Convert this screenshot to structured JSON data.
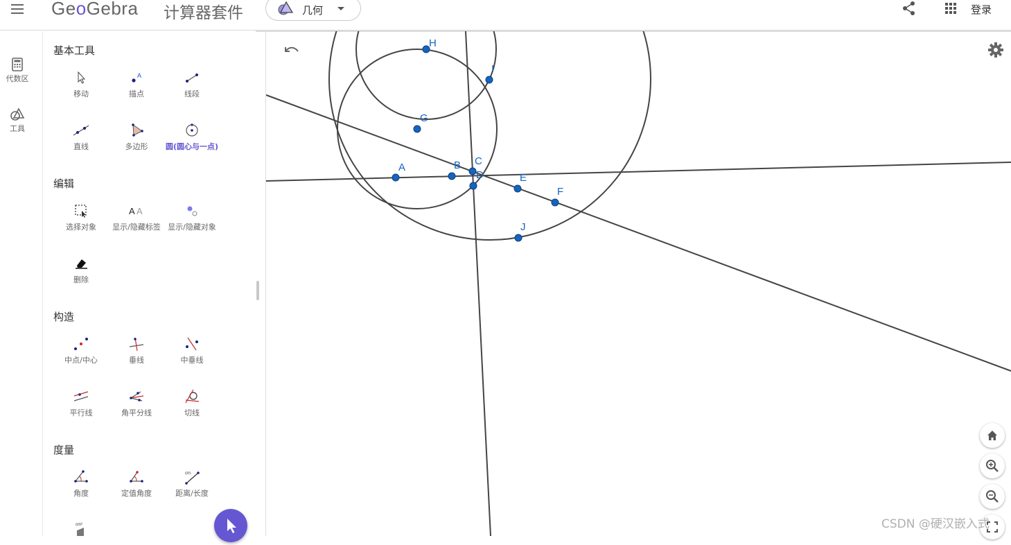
{
  "header": {
    "logo": {
      "left": "Ge",
      "oo": "o",
      "right": "Gebra"
    },
    "suite_title": "计算器套件",
    "app_selector": {
      "selected": "几何"
    },
    "login": "登录"
  },
  "rail": {
    "algebra": "代数区",
    "tools": "工具"
  },
  "tools_panel": {
    "sections": {
      "basic": "基本工具",
      "edit": "编辑",
      "construct": "构造",
      "measure": "度量"
    },
    "tools": {
      "move": "移动",
      "point": "描点",
      "segment": "线段",
      "line": "直线",
      "polygon": "多边形",
      "circle": "圆(圆心与一点)",
      "select": "选择对象",
      "show_hide_label": "显示/隐藏标签",
      "show_hide_object": "显示/隐藏对象",
      "delete": "删除",
      "midpoint": "中点/中心",
      "perpendicular": "垂线",
      "perp_bisector": "中垂线",
      "parallel": "平行线",
      "angle_bisector": "角平分线",
      "tangent": "切线",
      "angle": "角度",
      "fixed_angle": "定值角度",
      "distance": "距离/长度",
      "area_icon_text": "cm²"
    }
  },
  "graphics": {
    "points": [
      {
        "name": "A"
      },
      {
        "name": "B"
      },
      {
        "name": "C"
      },
      {
        "name": "D"
      },
      {
        "name": "E"
      },
      {
        "name": "F"
      },
      {
        "name": "G"
      },
      {
        "name": "H"
      },
      {
        "name": "I"
      },
      {
        "name": "J"
      }
    ],
    "colors": {
      "point_fill": "#1565c0",
      "point_stroke": "#0d3c7a",
      "label": "#1565c0",
      "line": "#444444",
      "accent": "#6557d2"
    }
  },
  "watermark": "CSDN @硬汉嵌入式"
}
